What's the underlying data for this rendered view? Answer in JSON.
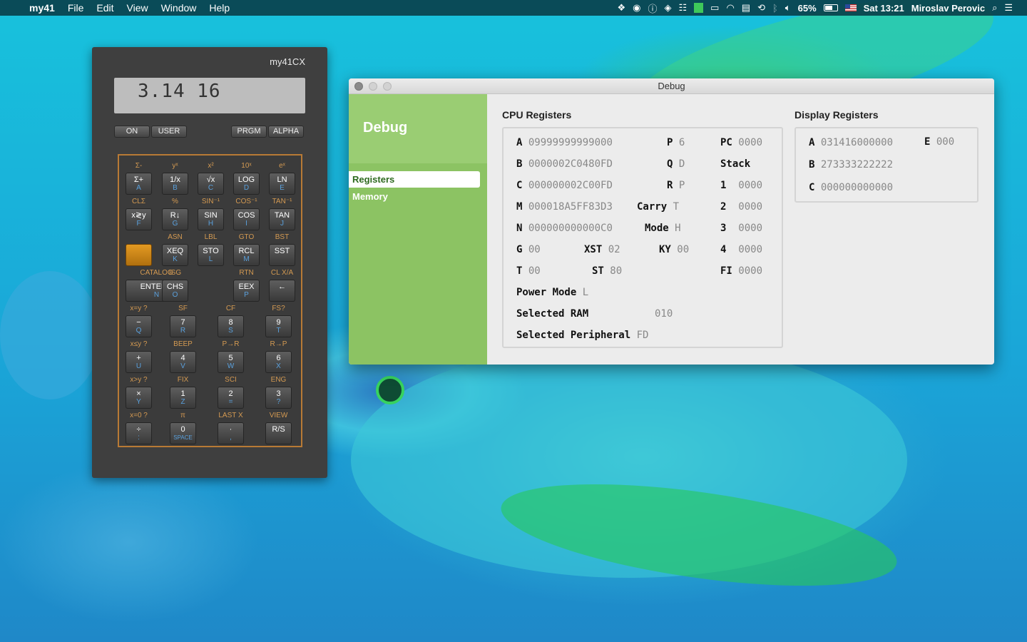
{
  "menubar": {
    "app": "my41",
    "menus": [
      "File",
      "Edit",
      "View",
      "Window",
      "Help"
    ],
    "status": {
      "battery": "65%",
      "clock": "Sat 13:21",
      "user": "Miroslav Perovic"
    }
  },
  "calculator": {
    "title": "my41CX",
    "display": "3.14 16",
    "top_buttons": [
      "ON",
      "USER",
      "PRGM",
      "ALPHA"
    ],
    "keys": {
      "r1": {
        "f": [
          "Σ-",
          "yˣ",
          "x²",
          "10ˣ",
          "eˣ"
        ],
        "k": [
          "Σ+",
          "1/x",
          "√x",
          "LOG",
          "LN"
        ],
        "a": [
          "A",
          "B",
          "C",
          "D",
          "E"
        ]
      },
      "r2": {
        "f": [
          "CLΣ",
          "%",
          "SIN⁻¹",
          "COS⁻¹",
          "TAN⁻¹"
        ],
        "k": [
          "x≷y",
          "R↓",
          "SIN",
          "COS",
          "TAN"
        ],
        "a": [
          "F",
          "G",
          "H",
          "I",
          "J"
        ]
      },
      "r3": {
        "f": [
          "",
          "ASN",
          "LBL",
          "GTO",
          "BST"
        ],
        "k": [
          "",
          "XEQ",
          "STO",
          "RCL",
          "SST"
        ],
        "a": [
          "",
          "K",
          "L",
          "M",
          ""
        ]
      },
      "r4": {
        "f": [
          "CATALOG",
          "ISG",
          "RTN",
          "CL X/A"
        ],
        "k": [
          "ENTER ↑",
          "CHS",
          "EEX",
          "←"
        ],
        "a": [
          "N",
          "O",
          "P",
          ""
        ]
      },
      "r5": {
        "f": [
          "x=y ?",
          "SF",
          "CF",
          "FS?"
        ],
        "k": [
          "−",
          "7",
          "8",
          "9"
        ],
        "a": [
          "Q",
          "R",
          "S",
          "T"
        ]
      },
      "r6": {
        "f": [
          "x≤y ?",
          "BEEP",
          "P→R",
          "R→P"
        ],
        "k": [
          "+",
          "4",
          "5",
          "6"
        ],
        "a": [
          "U",
          "V",
          "W",
          "X"
        ]
      },
      "r7": {
        "f": [
          "x>y ?",
          "FIX",
          "SCI",
          "ENG"
        ],
        "k": [
          "×",
          "1",
          "2",
          "3"
        ],
        "a": [
          "Y",
          "Z",
          "=",
          "?"
        ]
      },
      "r8": {
        "f": [
          "x=0 ?",
          "π",
          "LAST X",
          "VIEW"
        ],
        "k": [
          "÷",
          "0",
          "·",
          "R/S"
        ],
        "a": [
          ":",
          "SPACE",
          ",",
          ""
        ]
      }
    }
  },
  "debug": {
    "window_title": "Debug",
    "sidebar_title": "Debug",
    "nav": [
      "Registers",
      "Memory"
    ],
    "cpu_title": "CPU Registers",
    "display_title": "Display Registers",
    "cpu": {
      "A": "09999999999000",
      "B": "0000002C0480FD",
      "C": "000000002C00FD",
      "M": "000018A5FF83D3",
      "N": "000000000000C0",
      "G": "00",
      "T": "00",
      "XST": "02",
      "ST": "80",
      "P": "6",
      "Q": "D",
      "R": "P",
      "Carry": "T",
      "Mode": "H",
      "KY": "00",
      "PC": "0000",
      "stack_label": "Stack",
      "stack": [
        "0000",
        "0000",
        "0000",
        "0000"
      ],
      "FI": "0000",
      "power_mode_label": "Power Mode",
      "power_mode": "L",
      "selected_ram_label": "Selected RAM",
      "selected_ram": "010",
      "selected_peripheral_label": "Selected Peripheral",
      "selected_peripheral": "FD"
    },
    "display": {
      "A": "031416000000",
      "B": "273333222222",
      "C": "000000000000",
      "E": "000"
    }
  }
}
